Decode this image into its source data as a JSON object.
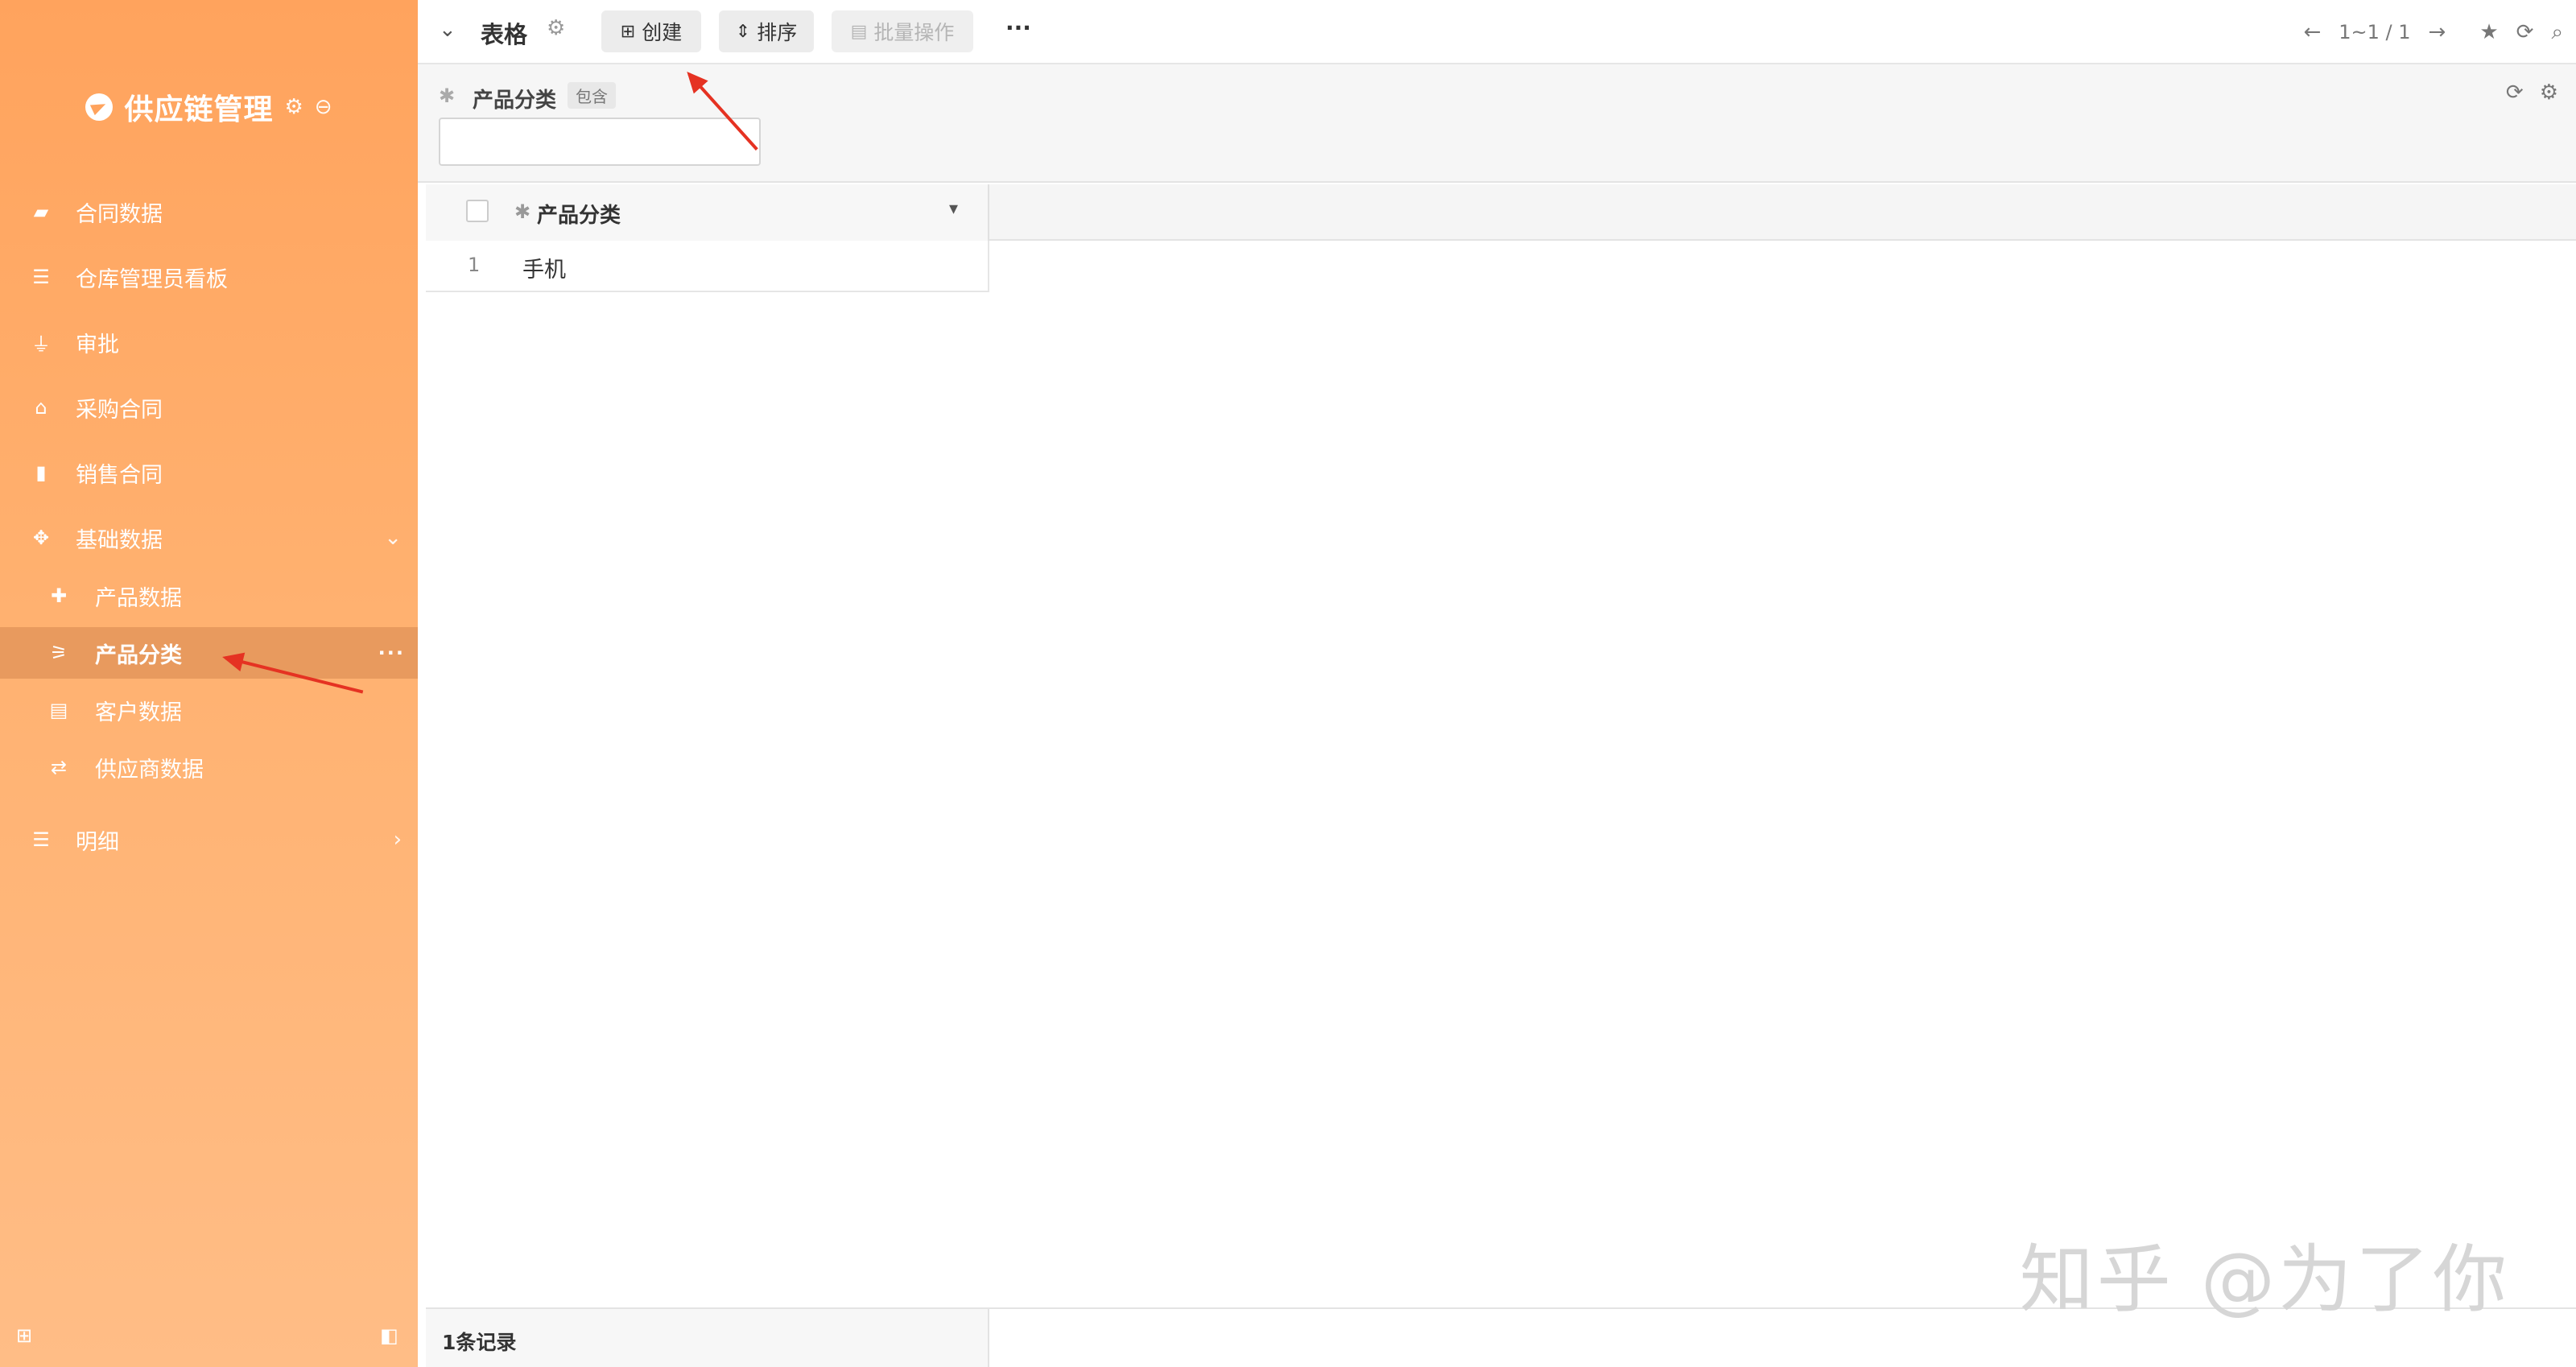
{
  "app": {
    "title": "供应链管理"
  },
  "sidebar": {
    "items": [
      {
        "label": "合同数据",
        "icon": "briefcase-icon"
      },
      {
        "label": "仓库管理员看板",
        "icon": "table-icon"
      },
      {
        "label": "审批",
        "icon": "stamp-icon"
      },
      {
        "label": "采购合同",
        "icon": "basket-icon"
      },
      {
        "label": "销售合同",
        "icon": "book-icon"
      },
      {
        "label": "基础数据",
        "icon": "crosshair-icon"
      },
      {
        "label": "产品数据",
        "icon": "puzzle-icon"
      },
      {
        "label": "产品分类",
        "icon": "sign-icon"
      },
      {
        "label": "客户数据",
        "icon": "id-card-icon"
      },
      {
        "label": "供应商数据",
        "icon": "retweet-icon"
      },
      {
        "label": "明细",
        "icon": "table-icon"
      }
    ]
  },
  "toolbar": {
    "view_title": "表格",
    "create_label": "创建",
    "sort_label": "排序",
    "batch_label": "批量操作",
    "more_label": "···",
    "pager_text": "1~1 / 1"
  },
  "filter": {
    "field_label": "产品分类",
    "operator_tag": "包含",
    "value": ""
  },
  "table": {
    "columns": [
      "产品分类"
    ],
    "rows": [
      {
        "index": "1",
        "value": "手机"
      }
    ],
    "footer_count": "1条记录"
  },
  "watermark": "知乎 @为了你",
  "colors": {
    "sidebar": "#ffa35d",
    "active_item": "#e89a5e",
    "annotation_arrow": "#e53222"
  }
}
